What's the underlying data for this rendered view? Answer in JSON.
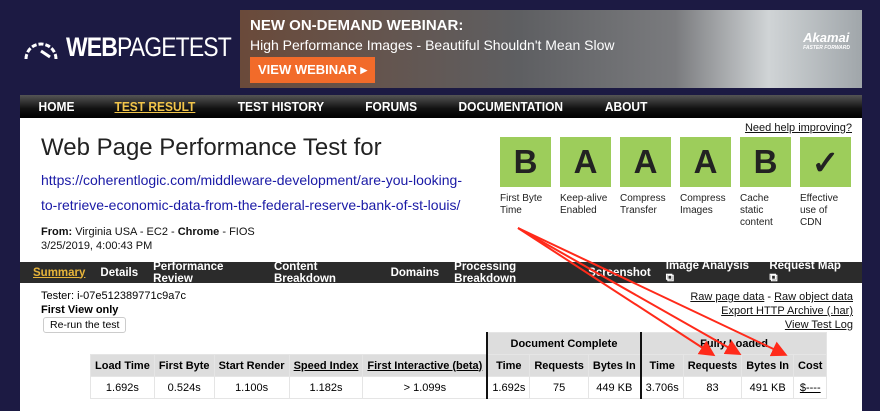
{
  "logo": {
    "text_bold": "WEB",
    "text_light": "PAGETEST"
  },
  "banner": {
    "headline": "NEW ON-DEMAND WEBINAR:",
    "subtitle": "High Performance Images - Beautiful Shouldn't Mean Slow",
    "button": "VIEW WEBINAR ▸",
    "brand": "Akamai",
    "brand_tag": "FASTER FORWARD"
  },
  "nav": [
    "HOME",
    "TEST RESULT",
    "TEST HISTORY",
    "FORUMS",
    "DOCUMENTATION",
    "ABOUT"
  ],
  "nav_active": "TEST RESULT",
  "header": {
    "title": "Web Page Performance Test for",
    "url": "https://coherentlogic.com/middleware-development/are-you-looking-to-retrieve-economic-data-from-the-federal-reserve-bank-of-st-louis/",
    "from_label": "From:",
    "from_location": " Virginia USA - EC2 - ",
    "browser": "Chrome",
    "conn": " - FIOS",
    "date": "3/25/2019, 4:00:43 PM",
    "help": "Need help improving?"
  },
  "grades": [
    {
      "grade": "B",
      "label": "First Byte Time"
    },
    {
      "grade": "A",
      "label": "Keep-alive Enabled"
    },
    {
      "grade": "A",
      "label": "Compress Transfer"
    },
    {
      "grade": "A",
      "label": "Compress Images"
    },
    {
      "grade": "B",
      "label": "Cache static content"
    },
    {
      "grade": "✓",
      "label": "Effective use of CDN"
    }
  ],
  "grade_color": "#9dcd5b",
  "tabs": [
    "Summary",
    "Details",
    "Performance Review",
    "Content Breakdown",
    "Domains",
    "Processing Breakdown",
    "Screenshot",
    "Image Analysis ⧉",
    "Request Map ⧉"
  ],
  "summary": {
    "tester": "Tester: i-07e512389771c9a7c",
    "first_view": "First View only",
    "rerun": "Re-run the test",
    "links": {
      "raw_page": "Raw page data",
      "sep": " - ",
      "raw_object": "Raw object data",
      "har": "Export HTTP Archive (.har)",
      "log": "View Test Log"
    }
  },
  "table": {
    "group_doc": "Document Complete",
    "group_full": "Fully Loaded",
    "headers": [
      "Load Time",
      "First Byte",
      "Start Render",
      "Speed Index",
      "First Interactive (beta)",
      "Time",
      "Requests",
      "Bytes In",
      "Time",
      "Requests",
      "Bytes In",
      "Cost"
    ],
    "values": [
      "1.692s",
      "0.524s",
      "1.100s",
      "1.182s",
      "> 1.099s",
      "1.692s",
      "75",
      "449 KB",
      "3.706s",
      "83",
      "491 KB",
      "$----"
    ]
  },
  "annotation_color": "#ff2a1a"
}
